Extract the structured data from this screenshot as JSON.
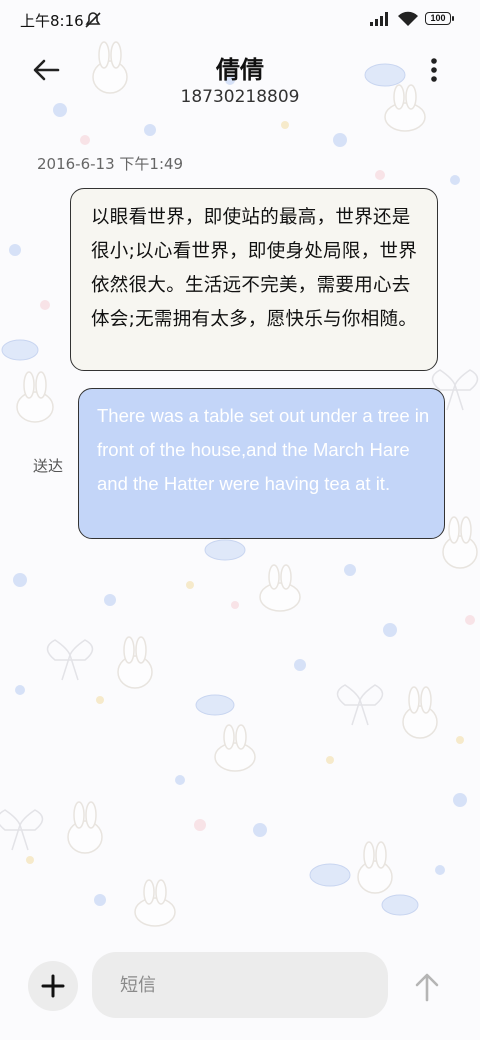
{
  "status_bar": {
    "time": "上午8:16",
    "battery": "100",
    "icons": [
      "mute-icon",
      "signal-icon",
      "wifi-icon",
      "battery-icon"
    ]
  },
  "header": {
    "contact_name": "倩倩",
    "contact_number": "18730218809",
    "icons": [
      "back-arrow-icon",
      "more-vertical-icon"
    ]
  },
  "conversation": {
    "timestamp": "2016-6-13 下午1:49",
    "messages": [
      {
        "direction": "incoming",
        "text": "以眼看世界，即使站的最高，世界还是很小;以心看世界，即使身处局限，世界依然很大。生活远不完美，需要用心去体会;无需拥有太多，愿快乐与你相随。"
      },
      {
        "direction": "outgoing",
        "text": "There was a table set out under a tree in front of the house,and the March Hare and the Hatter were having tea at it.",
        "status": "送达"
      }
    ]
  },
  "composer": {
    "placeholder": "短信",
    "icons": [
      "plus-icon",
      "send-arrow-icon"
    ]
  },
  "colors": {
    "outgoing_bubble": "#c3d5f8",
    "incoming_bubble": "#f7f6f1",
    "input_background": "#ececec"
  }
}
